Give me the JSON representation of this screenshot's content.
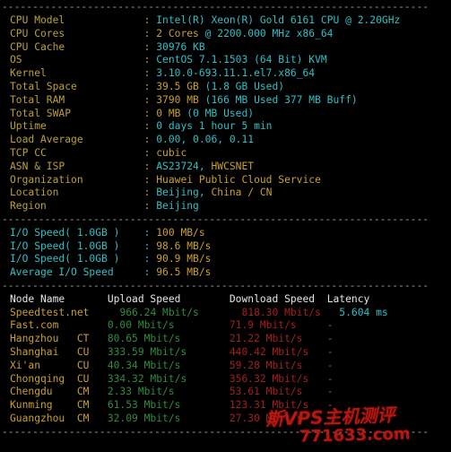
{
  "terminal": {
    "separator": "----------------------------------------------------------------------",
    "colors": {
      "background": "#000000",
      "label": "#b9a034",
      "value_cyan": "#2fbfc4",
      "value_yellow": "#c8a02a",
      "header_white": "#e6e6e6",
      "upload_green": "#2f8b3e",
      "download_red": "#a3201f",
      "separator_gray": "#9a9a9a",
      "watermark_red": "#c21a12"
    }
  },
  "system_info": {
    "rows": [
      {
        "label": "CPU Model",
        "colon": ":",
        "value_cyan": "Intel(R) Xeon(R) Gold 6161 CPU @ 2.20GHz",
        "value_yellow": ""
      },
      {
        "label": "CPU Cores",
        "colon": ":",
        "value_yellow": "2 Cores",
        "value_cyan": " @ 2200.000 MHz x86_64"
      },
      {
        "label": "CPU Cache",
        "colon": ":",
        "value_cyan": "30976 KB",
        "value_yellow": ""
      },
      {
        "label": "OS",
        "colon": ":",
        "value_cyan": "CentOS 7.1.1503 (64 Bit) KVM",
        "value_yellow": ""
      },
      {
        "label": "Kernel",
        "colon": ":",
        "value_cyan": "3.10.0-693.11.1.el7.x86_64",
        "value_yellow": ""
      },
      {
        "label": "Total Space",
        "colon": ":",
        "value_yellow": "39.5 GB",
        "value_cyan": " (1.8 GB Used)"
      },
      {
        "label": "Total RAM",
        "colon": ":",
        "value_yellow": "3790 MB",
        "value_cyan": " (166 MB Used 377 MB Buff)"
      },
      {
        "label": "Total SWAP",
        "colon": ":",
        "value_yellow": "0 MB",
        "value_cyan": " (0 MB Used)"
      },
      {
        "label": "Uptime",
        "colon": ":",
        "value_cyan": "0 days 1 hour 5 min",
        "value_yellow": ""
      },
      {
        "label": "Load Average",
        "colon": ":",
        "value_cyan": "0.00, 0.06, 0.11",
        "value_yellow": ""
      },
      {
        "label": "TCP CC",
        "colon": ":",
        "value_yellow": "cubic",
        "value_cyan": ""
      },
      {
        "label": "ASN & ISP",
        "colon": ":",
        "value_cyan": "AS23724, ",
        "value_yellow": "HWCSNET"
      },
      {
        "label": "Organization",
        "colon": ":",
        "value_yellow": "Huawei Public Cloud Service",
        "value_cyan": ""
      },
      {
        "label": "Location",
        "colon": ":",
        "value_cyan": "Beijing, ",
        "value_yellow": "China / CN"
      },
      {
        "label": "Region",
        "colon": ":",
        "value_cyan": "Beijing",
        "value_yellow": ""
      }
    ]
  },
  "io_test": {
    "rows": [
      {
        "label": "I/O Speed( 1.0GB )",
        "colon": ":",
        "value": "100 MB/s"
      },
      {
        "label": "I/O Speed( 1.0GB )",
        "colon": ":",
        "value": "98.6 MB/s"
      },
      {
        "label": "I/O Speed( 1.0GB )",
        "colon": ":",
        "value": "90.9 MB/s"
      },
      {
        "label": "Average I/O Speed",
        "colon": ":",
        "value": "96.5 MB/s"
      }
    ]
  },
  "speedtest": {
    "headers": {
      "node": "Node Name",
      "upload": "Upload Speed",
      "download": "Download Speed",
      "latency": "Latency"
    },
    "rows": [
      {
        "node": "Speedtest.net",
        "isp": "",
        "upload": "966.24 Mbit/s",
        "download": "818.30 Mbit/s",
        "latency": "5.604 ms"
      },
      {
        "node": "Fast.com",
        "isp": "",
        "upload": "0.00 Mbit/s",
        "download": "71.9 Mbit/s",
        "latency": "-"
      },
      {
        "node": "Hangzhou",
        "isp": "CT",
        "upload": "80.65 Mbit/s",
        "download": "21.22 Mbit/s",
        "latency": "-"
      },
      {
        "node": "Shanghai",
        "isp": "CU",
        "upload": "333.59 Mbit/s",
        "download": "440.42 Mbit/s",
        "latency": "-"
      },
      {
        "node": "Xi'an",
        "isp": "CU",
        "upload": "40.34 Mbit/s",
        "download": "59.28 Mbit/s",
        "latency": "-"
      },
      {
        "node": "Chongqing",
        "isp": "CU",
        "upload": "334.32 Mbit/s",
        "download": "356.32 Mbit/s",
        "latency": "-"
      },
      {
        "node": "Chengdu",
        "isp": "CM",
        "upload": "2.33 Mbit/s",
        "download": "53.61 Mbit/s",
        "latency": "-"
      },
      {
        "node": "Kunming",
        "isp": "CM",
        "upload": "61.53 Mbit/s",
        "download": "123.31 Mbit/s",
        "latency": "-"
      },
      {
        "node": "Guangzhou",
        "isp": "CM",
        "upload": "32.09 Mbit/s",
        "download": "27.30 Mbit/s",
        "latency": "-"
      }
    ]
  },
  "watermark": {
    "line1": "斯VPS主机测评",
    "line2": "771633.com"
  }
}
